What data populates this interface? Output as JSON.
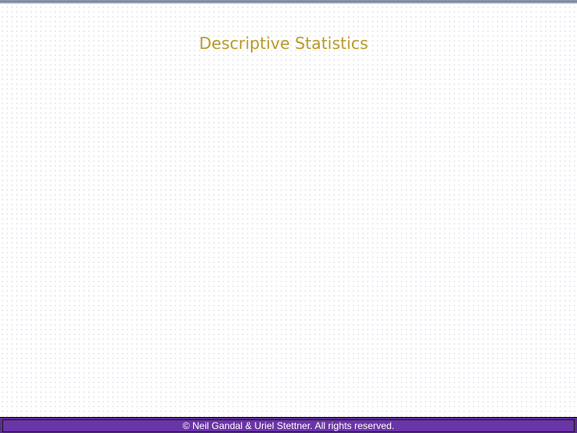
{
  "slide": {
    "title": "Descriptive Statistics"
  },
  "footer": {
    "copyright": "© Neil Gandal & Uriel Stettner. All rights reserved."
  },
  "colors": {
    "title": "#b89a28",
    "footer_bar": "#5c2d91",
    "footer_text": "#ffffff",
    "background": "#ffffff"
  }
}
